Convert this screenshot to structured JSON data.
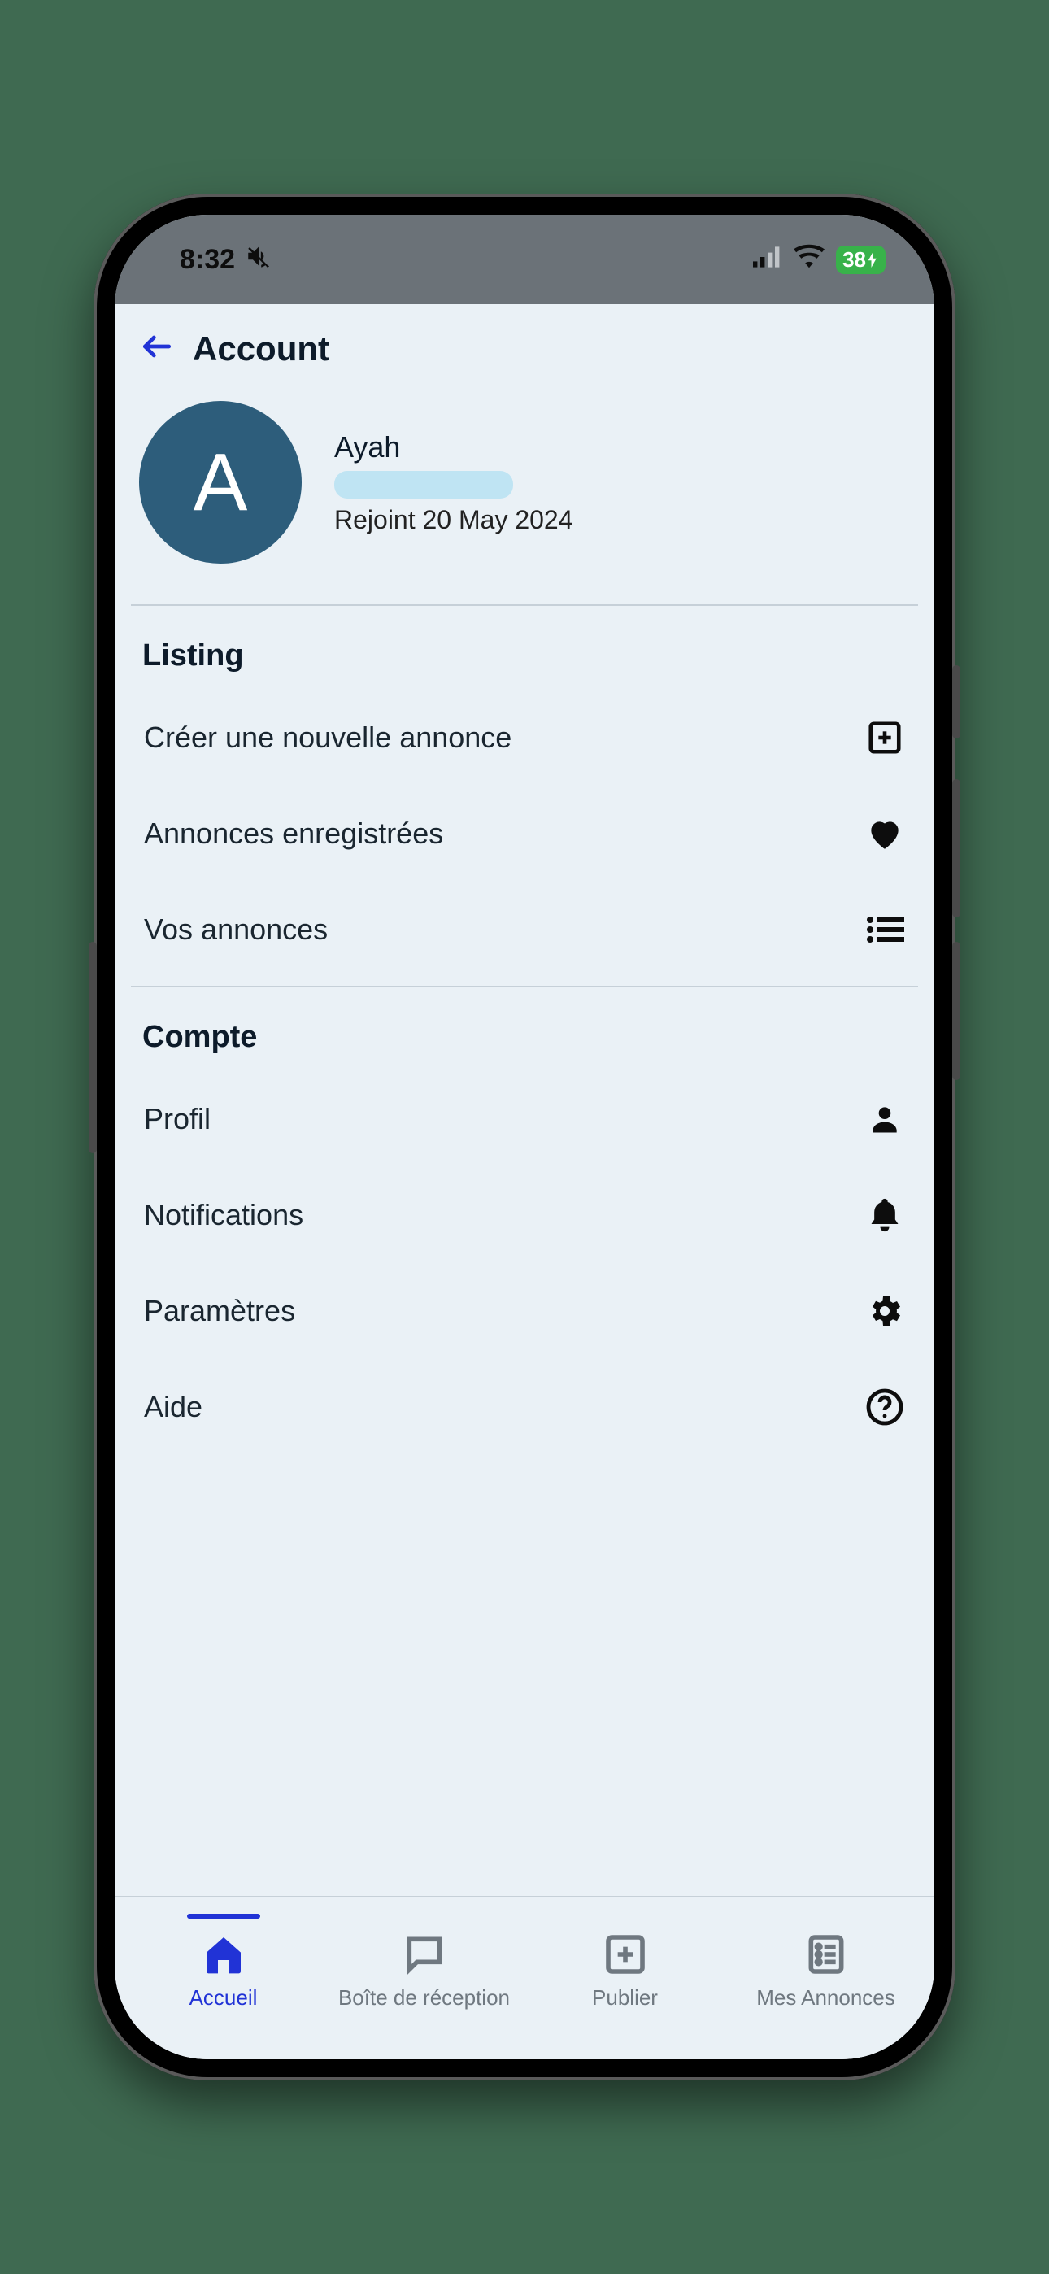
{
  "status": {
    "time": "8:32",
    "battery": "38"
  },
  "header": {
    "title": "Account"
  },
  "profile": {
    "initial": "A",
    "name": "Ayah",
    "joined": "Rejoint 20 May 2024"
  },
  "sections": {
    "listing": {
      "title": "Listing",
      "items": [
        {
          "label": "Créer une nouvelle annonce",
          "icon": "plus-box"
        },
        {
          "label": "Annonces enregistrées",
          "icon": "heart"
        },
        {
          "label": "Vos annonces",
          "icon": "list"
        }
      ]
    },
    "compte": {
      "title": "Compte",
      "items": [
        {
          "label": "Profil",
          "icon": "person"
        },
        {
          "label": "Notifications",
          "icon": "bell"
        },
        {
          "label": "Paramètres",
          "icon": "gear"
        },
        {
          "label": "Aide",
          "icon": "help"
        }
      ]
    }
  },
  "nav": {
    "items": [
      {
        "label": "Accueil",
        "icon": "home",
        "active": true
      },
      {
        "label": "Boîte de réception",
        "icon": "chat",
        "active": false
      },
      {
        "label": "Publier",
        "icon": "plus-box",
        "active": false
      },
      {
        "label": "Mes Annonces",
        "icon": "doc-list",
        "active": false
      }
    ]
  }
}
